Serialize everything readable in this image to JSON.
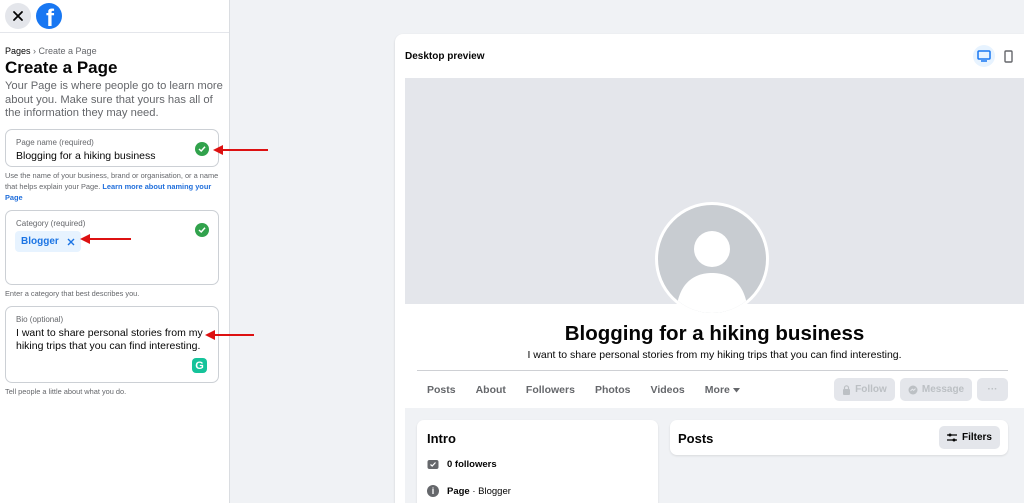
{
  "sidebar": {
    "logo_letter": "f",
    "breadcrumb_root": "Pages",
    "breadcrumb_sep": " › ",
    "breadcrumb_current": "Create a Page",
    "title": "Create a Page",
    "subtitle": "Your Page is where people go to learn more about you. Make sure that yours has all of the information they may need.",
    "page_name": {
      "label": "Page name (required)",
      "value": "Blogging for a hiking business",
      "help": "Use the name of your business, brand or organisation, or a name that helps explain your Page.",
      "help_link": "Learn more about naming your Page"
    },
    "category": {
      "label": "Category (required)",
      "chip": "Blogger",
      "help": "Enter a category that best describes you."
    },
    "bio": {
      "label": "Bio (optional)",
      "value": "I want to share personal stories from my hiking trips that you can find interesting.",
      "help": "Tell people a little about what you do."
    }
  },
  "preview": {
    "title": "Desktop preview",
    "page_name": "Blogging for a hiking business",
    "page_bio": "I want to share personal stories from my hiking trips that you can find interesting.",
    "tabs": [
      "Posts",
      "About",
      "Followers",
      "Photos",
      "Videos",
      "More"
    ],
    "follow_label": "Follow",
    "message_label": "Message",
    "more_actions_label": "···",
    "intro": {
      "title": "Intro",
      "followers": "0 followers",
      "page_type_label": "Page",
      "page_type_sep": " · ",
      "page_type_value": "Blogger"
    },
    "posts": {
      "title": "Posts",
      "filters_label": "Filters"
    }
  },
  "colors": {
    "brand_blue": "#1877f2",
    "success_green": "#31a24c",
    "annotation_red": "#dd1111",
    "grammarly_green": "#15c39a"
  },
  "icons": [
    "close-icon",
    "facebook-logo-icon",
    "check-circle-icon",
    "chip-remove-icon",
    "grammarly-icon",
    "desktop-icon",
    "mobile-icon",
    "lock-icon",
    "messenger-icon",
    "followers-icon",
    "info-icon",
    "filter-icon",
    "caret-down-icon"
  ]
}
